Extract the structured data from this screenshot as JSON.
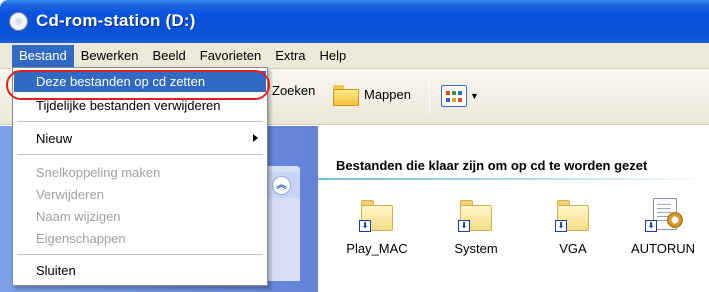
{
  "window": {
    "title": "Cd-rom-station (D:)"
  },
  "menubar": {
    "items": [
      "Bestand",
      "Bewerken",
      "Beeld",
      "Favorieten",
      "Extra",
      "Help"
    ]
  },
  "toolbar": {
    "search_label": "Zoeken",
    "folders_label": "Mappen"
  },
  "file_menu": {
    "items": [
      {
        "label": "Deze bestanden op cd zetten",
        "state": "highlighted"
      },
      {
        "label": "Tijdelijke bestanden verwijderen",
        "state": "enabled"
      },
      {
        "label": "Nieuw",
        "state": "enabled",
        "submenu": true
      },
      {
        "label": "Snelkoppeling maken",
        "state": "disabled"
      },
      {
        "label": "Verwijderen",
        "state": "disabled"
      },
      {
        "label": "Naam wijzigen",
        "state": "disabled"
      },
      {
        "label": "Eigenschappen",
        "state": "disabled"
      },
      {
        "label": "Sluiten",
        "state": "enabled"
      }
    ]
  },
  "left_pane": {
    "partial_text": "n"
  },
  "content": {
    "group_header": "Bestanden die klaar zijn om op cd te worden gezet",
    "files": [
      {
        "name": "Play_MAC",
        "type": "folder-shortcut"
      },
      {
        "name": "System",
        "type": "folder-shortcut"
      },
      {
        "name": "VGA",
        "type": "folder-shortcut"
      },
      {
        "name": "AUTORUN",
        "type": "settings-file"
      }
    ]
  },
  "colors": {
    "title_bar": "#0751d9",
    "highlight": "#316ac5",
    "annotation_oval": "#e3201b"
  }
}
